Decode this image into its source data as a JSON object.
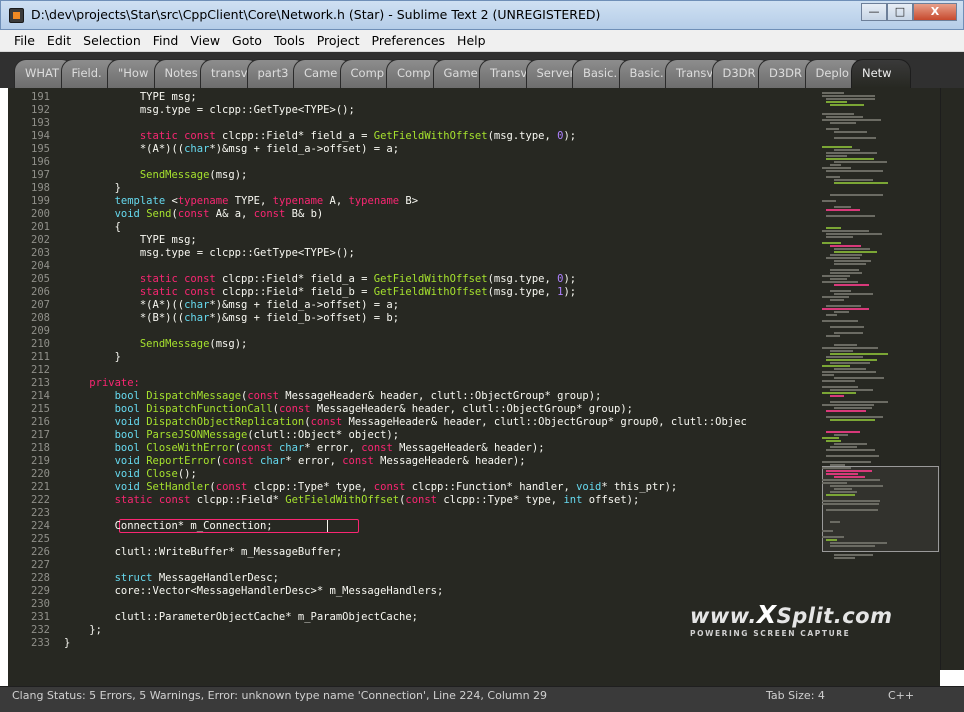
{
  "window": {
    "title": "D:\\dev\\projects\\Star\\src\\CppClient\\Core\\Network.h (Star) - Sublime Text 2 (UNREGISTERED)",
    "minimize": "—",
    "maximize": "□",
    "close": "X"
  },
  "menu": [
    "File",
    "Edit",
    "Selection",
    "Find",
    "View",
    "Goto",
    "Tools",
    "Project",
    "Preferences",
    "Help"
  ],
  "tabs": [
    "WHAT",
    "Field.",
    "\"How",
    "Notes",
    "transv",
    "part3",
    "Came",
    "Comp",
    "Comp",
    "Game",
    "Transv",
    "Server",
    "Basic.",
    "Basic.",
    "Transv",
    "D3DR",
    "D3DR",
    "Deplo",
    "Netw"
  ],
  "active_tab_index": 18,
  "lines": [
    {
      "n": "191",
      "code": "            TYPE msg;"
    },
    {
      "n": "192",
      "code": "            msg.type = clcpp::GetType<TYPE>();"
    },
    {
      "n": "193",
      "code": ""
    },
    {
      "n": "194",
      "code": "            <k>static const</k> clcpp::Field* field_a = <f>GetFieldWithOffset</f>(msg.type, <n>0</n>);"
    },
    {
      "n": "195",
      "code": "            *(A*)((<t>char</t>*)&msg + field_a->offset) = a;"
    },
    {
      "n": "196",
      "code": ""
    },
    {
      "n": "197",
      "code": "            <f>SendMessage</f>(msg);"
    },
    {
      "n": "198",
      "code": "        }"
    },
    {
      "n": "199",
      "code": "        <t>template</t> <<k>typename</k> TYPE, <k>typename</k> A, <k>typename</k> B>"
    },
    {
      "n": "200",
      "code": "        <t>void</t> <f>Send</f>(<k>const</k> A& a, <k>const</k> B& b)"
    },
    {
      "n": "201",
      "code": "        {"
    },
    {
      "n": "202",
      "code": "            TYPE msg;"
    },
    {
      "n": "203",
      "code": "            msg.type = clcpp::GetType<TYPE>();"
    },
    {
      "n": "204",
      "code": ""
    },
    {
      "n": "205",
      "code": "            <k>static const</k> clcpp::Field* field_a = <f>GetFieldWithOffset</f>(msg.type, <n>0</n>);"
    },
    {
      "n": "206",
      "code": "            <k>static const</k> clcpp::Field* field_b = <f>GetFieldWithOffset</f>(msg.type, <n>1</n>);"
    },
    {
      "n": "207",
      "code": "            *(A*)((<t>char</t>*)&msg + field_a->offset) = a;"
    },
    {
      "n": "208",
      "code": "            *(B*)((<t>char</t>*)&msg + field_b->offset) = b;"
    },
    {
      "n": "209",
      "code": ""
    },
    {
      "n": "210",
      "code": "            <f>SendMessage</f>(msg);"
    },
    {
      "n": "211",
      "code": "        }"
    },
    {
      "n": "212",
      "code": ""
    },
    {
      "n": "213",
      "code": "    <k>private:</k>"
    },
    {
      "n": "214",
      "code": "        <t>bool</t> <f>DispatchMessage</f>(<k>const</k> MessageHeader& header, clutl::ObjectGroup* group);"
    },
    {
      "n": "215",
      "code": "        <t>bool</t> <f>DispatchFunctionCall</f>(<k>const</k> MessageHeader& header, clutl::ObjectGroup* group);"
    },
    {
      "n": "216",
      "code": "        <t>void</t> <f>DispatchObjectReplication</f>(<k>const</k> MessageHeader& header, clutl::ObjectGroup* group0, clutl::Objec"
    },
    {
      "n": "217",
      "code": "        <t>bool</t> <f>ParseJSONMessage</f>(clutl::Object* object);"
    },
    {
      "n": "218",
      "code": "        <t>bool</t> <f>CloseWithError</f>(<k>const</k> <t>char</t>* error, <k>const</k> MessageHeader& header);"
    },
    {
      "n": "219",
      "code": "        <t>void</t> <f>ReportError</f>(<k>const</k> <t>char</t>* error, <k>const</k> MessageHeader& header);"
    },
    {
      "n": "220",
      "code": "        <t>void</t> <f>Close</f>();"
    },
    {
      "n": "221",
      "code": "        <t>void</t> <f>SetHandler</f>(<k>const</k> clcpp::Type* type, <k>const</k> clcpp::Function* handler, <t>void</t>* this_ptr);"
    },
    {
      "n": "222",
      "code": "        <k>static const</k> clcpp::Field* <f>GetFieldWithOffset</f>(<k>const</k> clcpp::Type* type, <t>int</t> offset);"
    },
    {
      "n": "223",
      "code": ""
    },
    {
      "n": "224",
      "code": "        Connection* m_Connection;"
    },
    {
      "n": "225",
      "code": ""
    },
    {
      "n": "226",
      "code": "        clutl::WriteBuffer* m_MessageBuffer;"
    },
    {
      "n": "227",
      "code": ""
    },
    {
      "n": "228",
      "code": "        <t>struct</t> MessageHandlerDesc;"
    },
    {
      "n": "229",
      "code": "        core::Vector<MessageHandlerDesc>* m_MessageHandlers;"
    },
    {
      "n": "230",
      "code": ""
    },
    {
      "n": "231",
      "code": "        clutl::ParameterObjectCache* m_ParamObjectCache;"
    },
    {
      "n": "232",
      "code": "    };"
    },
    {
      "n": "233",
      "code": "}"
    }
  ],
  "status": {
    "left": "Clang Status: 5 Errors, 5 Warnings, Error: unknown type name 'Connection', Line 224, Column 29",
    "tab_size": "Tab Size: 4",
    "syntax": "C++"
  },
  "watermark": {
    "brand_pre": "www.",
    "brand_x": "X",
    "brand_post": "Split.com",
    "tagline": "POWERING SCREEN CAPTURE"
  },
  "colors": {
    "editor_bg": "#272822",
    "keyword": "#f92672",
    "function": "#a6e22e",
    "type": "#66d9ef",
    "number": "#ae81ff",
    "text": "#f8f8f2"
  }
}
